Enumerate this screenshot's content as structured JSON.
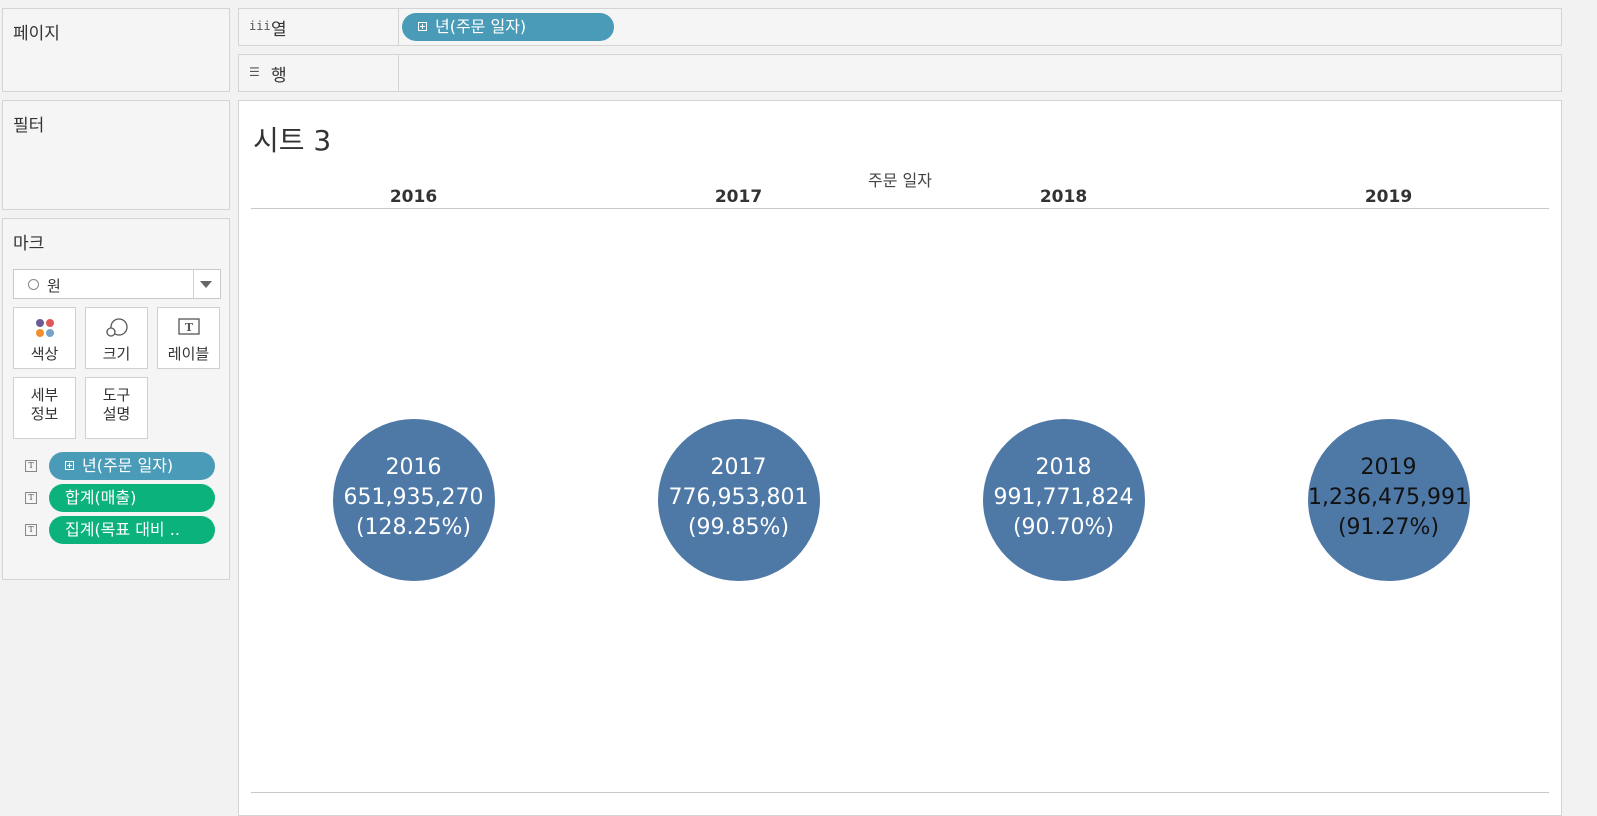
{
  "panels": {
    "pages_title": "페이지",
    "filters_title": "필터",
    "marks_title": "마크"
  },
  "marks": {
    "type_value": "원",
    "buttons": {
      "color": "색상",
      "size": "크기",
      "label": "레이블",
      "detail": "세부\n정보",
      "tooltip": "도구\n설명"
    },
    "fields": [
      {
        "label": "년(주문 일자)",
        "color": "#4a9bb8"
      },
      {
        "label": "합계(매출)",
        "color": "#0bb27c"
      },
      {
        "label": "집계(목표 대비 ..",
        "color": "#0bb27c"
      }
    ]
  },
  "shelves": {
    "columns_label": "열",
    "rows_label": "행",
    "columns_pill": "년(주문 일자)"
  },
  "view": {
    "sheet_title": "시트 3",
    "axis_field": "주문 일자"
  },
  "chart_data": {
    "type": "scatter",
    "mark": "circle",
    "color": "#4e79a7",
    "categories": [
      "2016",
      "2017",
      "2018",
      "2019"
    ],
    "series": [
      {
        "name": "합계(매출)",
        "values": [
          651935270,
          776953801,
          991771824,
          1236475991
        ]
      },
      {
        "name": "집계(목표 대비 ..",
        "values": [
          128.25,
          99.85,
          90.7,
          91.27
        ]
      }
    ],
    "labels": [
      {
        "year": "2016",
        "sales": "651,935,270",
        "ratio": "(128.25%)"
      },
      {
        "year": "2017",
        "sales": "776,953,801",
        "ratio": "(99.85%)"
      },
      {
        "year": "2018",
        "sales": "991,771,824",
        "ratio": "(90.70%)"
      },
      {
        "year": "2019",
        "sales": "1,236,475,991",
        "ratio": "(91.27%)"
      }
    ],
    "xlabel": "주문 일자"
  }
}
